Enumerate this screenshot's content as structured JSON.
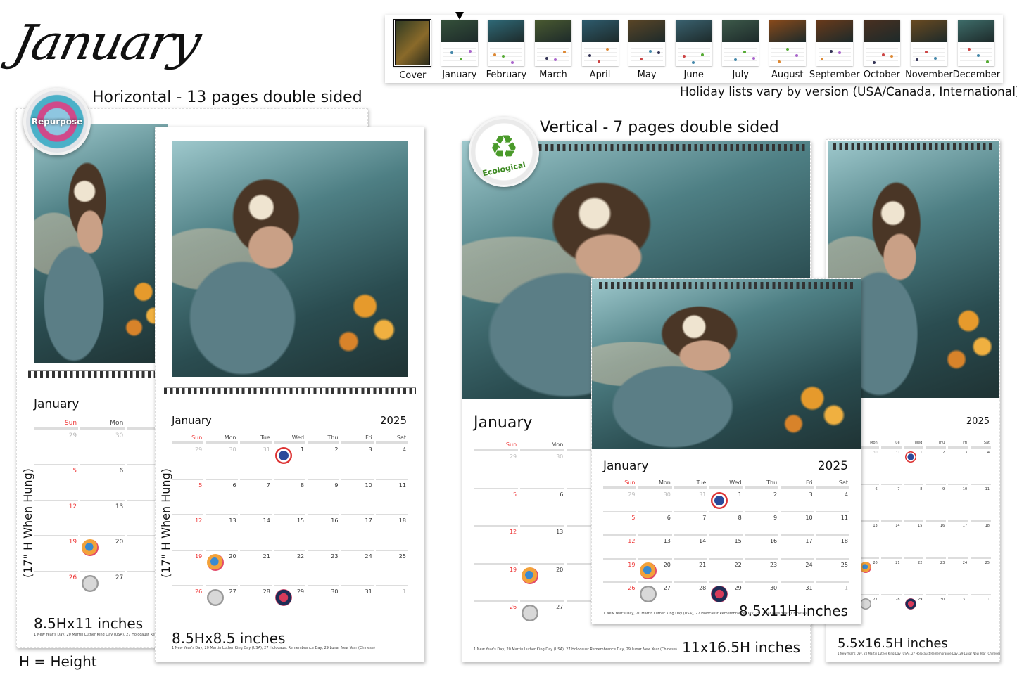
{
  "title": "January",
  "strip": {
    "items": [
      {
        "label": "Cover",
        "selected": false,
        "cover": true
      },
      {
        "label": "January",
        "selected": true
      },
      {
        "label": "February"
      },
      {
        "label": "March"
      },
      {
        "label": "April"
      },
      {
        "label": "May"
      },
      {
        "label": "June"
      },
      {
        "label": "July"
      },
      {
        "label": "August"
      },
      {
        "label": "September"
      },
      {
        "label": "October"
      },
      {
        "label": "November"
      },
      {
        "label": "December"
      }
    ],
    "note": "Holiday lists vary by version (USA/Canada, International)"
  },
  "horizontal": {
    "heading": "Horizontal - 13 pages double sided",
    "badge": "Repurpose",
    "hung_note": "(17\" H When Hung)",
    "height_legend": "H = Height",
    "large": {
      "size": "8.5Hx11 inches",
      "footnote": "1 New Year's Day, 20 Martin Luther King Day (USA), 27 Holocaust Remembrance Day, 29 Lunar New Year (Chinese)"
    },
    "small": {
      "size": "8.5Hx8.5 inches",
      "footnote": "1 New Year's Day, 20 Martin Luther King Day (USA), 27 Holocaust Remembrance Day, 29 Lunar New Year (Chinese)"
    }
  },
  "vertical": {
    "heading": "Vertical - 7 pages double sided",
    "badge": "Ecological",
    "large": {
      "size": "11x16.5H inches",
      "footnote": "1 New Year's Day, 20 Martin Luther King Day (USA), 27 Holocaust Remembrance Day, 29 Lunar New Year (Chinese)"
    },
    "medium": {
      "size": "8.5x11H inches",
      "footnote": "1 New Year's Day, 20 Martin Luther King Day (USA), 27 Holocaust Remembrance Day, 29 Lunar New Year (Chinese)"
    },
    "narrow": {
      "size": "5.5x16.5H inches",
      "footnote": "1 New Year's Day, 20 Martin Luther King Day (USA), 27 Holocaust Remembrance Day, 29 Lunar New Year (Chinese)"
    }
  },
  "calendar": {
    "month": "January",
    "year": "2025",
    "weekdays": [
      "Sun",
      "Mon",
      "Tue",
      "Wed",
      "Thu",
      "Fri",
      "Sat"
    ],
    "weeks": [
      [
        "29",
        "30",
        "31",
        "1",
        "2",
        "3",
        "4"
      ],
      [
        "5",
        "6",
        "7",
        "8",
        "9",
        "10",
        "11"
      ],
      [
        "12",
        "13",
        "14",
        "15",
        "16",
        "17",
        "18"
      ],
      [
        "19",
        "20",
        "21",
        "22",
        "23",
        "24",
        "25"
      ],
      [
        "26",
        "27",
        "28",
        "29",
        "30",
        "31",
        "1"
      ]
    ],
    "muted": [
      [
        0,
        0
      ],
      [
        0,
        1
      ],
      [
        0,
        2
      ],
      [
        4,
        6
      ]
    ],
    "holidays": [
      {
        "week": 0,
        "day": 3,
        "name": "New Year's Day",
        "sticker": "s-ny"
      },
      {
        "week": 3,
        "day": 1,
        "name": "Martin Luther King Day (USA)",
        "sticker": "s-mlk"
      },
      {
        "week": 4,
        "day": 1,
        "name": "Holocaust Remembrance Day",
        "sticker": "s-hol"
      },
      {
        "week": 4,
        "day": 3,
        "name": "Lunar New Year (Chinese)",
        "sticker": "s-lny"
      }
    ]
  }
}
